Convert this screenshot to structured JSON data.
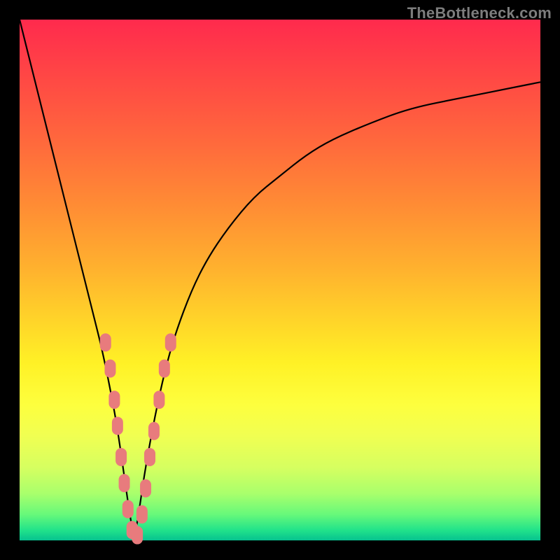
{
  "watermark": "TheBottleneck.com",
  "chart_data": {
    "type": "line",
    "title": "",
    "xlabel": "",
    "ylabel": "",
    "xlim": [
      0,
      100
    ],
    "ylim": [
      0,
      100
    ],
    "series": [
      {
        "name": "bottleneck-curve",
        "x": [
          0,
          2,
          4,
          6,
          8,
          10,
          12,
          14,
          16,
          18,
          19,
          20,
          21,
          22,
          23,
          24,
          26,
          28,
          30,
          33,
          36,
          40,
          45,
          50,
          55,
          60,
          67,
          75,
          85,
          95,
          100
        ],
        "y": [
          100,
          92,
          84,
          76,
          68,
          60,
          52,
          44,
          36,
          26,
          20,
          13,
          6,
          0,
          6,
          13,
          24,
          33,
          40,
          48,
          54,
          60,
          66,
          70,
          74,
          77,
          80,
          83,
          85,
          87,
          88
        ]
      }
    ],
    "markers": {
      "name": "highlighted-points",
      "color": "#e87b7d",
      "points": [
        {
          "x": 16.5,
          "y": 38
        },
        {
          "x": 17.4,
          "y": 33
        },
        {
          "x": 18.2,
          "y": 27
        },
        {
          "x": 18.8,
          "y": 22
        },
        {
          "x": 19.5,
          "y": 16
        },
        {
          "x": 20.1,
          "y": 11
        },
        {
          "x": 20.8,
          "y": 6
        },
        {
          "x": 21.6,
          "y": 2
        },
        {
          "x": 22.6,
          "y": 1
        },
        {
          "x": 23.5,
          "y": 5
        },
        {
          "x": 24.2,
          "y": 10
        },
        {
          "x": 25.0,
          "y": 16
        },
        {
          "x": 25.8,
          "y": 21
        },
        {
          "x": 26.8,
          "y": 27
        },
        {
          "x": 27.8,
          "y": 33
        },
        {
          "x": 29.0,
          "y": 38
        }
      ]
    }
  }
}
